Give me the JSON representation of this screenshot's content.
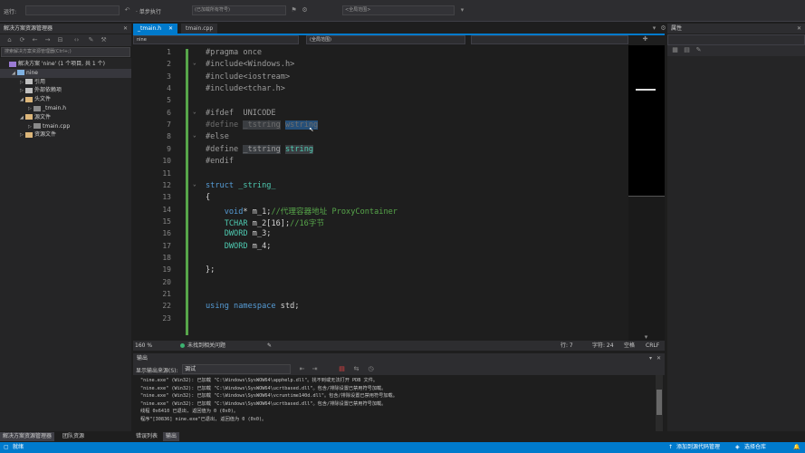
{
  "toolbar": {
    "find_label": "运行:",
    "find_value": "",
    "symbol_combo": "<全局范围>",
    "line_combo": "(已加载所有符号)",
    "nav_label": "· 单步执行",
    "nav_combo": ""
  },
  "solution_explorer": {
    "title": "解决方案资源管理器",
    "search_placeholder": "搜索解决方案资源管理器(Ctrl+;)",
    "items": [
      {
        "label": "解决方案 'nine' (1 个项目, 共 1 个)",
        "indent": 0,
        "expanded": false,
        "icon": "solution-icon"
      },
      {
        "label": "nine",
        "indent": 1,
        "expanded": true,
        "icon": "project-icon",
        "selected": true
      },
      {
        "label": "引用",
        "indent": 2,
        "expanded": false,
        "icon": "reference-icon"
      },
      {
        "label": "外部依赖项",
        "indent": 2,
        "expanded": false,
        "icon": "dependency-icon"
      },
      {
        "label": "头文件",
        "indent": 2,
        "expanded": true,
        "icon": "folder-icon"
      },
      {
        "label": "_tmain.h",
        "indent": 3,
        "expanded": false,
        "icon": "header-file-icon"
      },
      {
        "label": "源文件",
        "indent": 2,
        "expanded": true,
        "icon": "folder-icon"
      },
      {
        "label": "tmain.cpp",
        "indent": 3,
        "expanded": false,
        "icon": "cpp-file-icon"
      },
      {
        "label": "资源文件",
        "indent": 2,
        "expanded": false,
        "icon": "folder-icon"
      }
    ],
    "bottom_tabs": [
      "解决方案资源管理器",
      "团队资源"
    ]
  },
  "editor": {
    "tabs": [
      {
        "label": "_tmain.h",
        "active": true
      },
      {
        "label": "tmain.cpp",
        "active": false
      }
    ],
    "nav_project": "nine",
    "nav_scope": "(全局范围)",
    "nav_member": "",
    "lines": [
      {
        "n": "1",
        "parts": [
          {
            "t": "#pragma once",
            "c": "pp"
          }
        ]
      },
      {
        "n": "2",
        "parts": [
          {
            "t": "#include",
            "c": "pp"
          },
          {
            "t": "<Windows.h>",
            "c": "pp"
          }
        ]
      },
      {
        "n": "3",
        "parts": [
          {
            "t": "#include",
            "c": "pp"
          },
          {
            "t": "<iostream>",
            "c": "pp"
          }
        ]
      },
      {
        "n": "4",
        "parts": [
          {
            "t": "#include",
            "c": "pp"
          },
          {
            "t": "<tchar.h>",
            "c": "pp"
          }
        ]
      },
      {
        "n": "5",
        "parts": []
      },
      {
        "n": "6",
        "parts": [
          {
            "t": "#ifdef  UNICODE",
            "c": "pp"
          }
        ]
      },
      {
        "n": "7",
        "parts": [
          {
            "t": "#define ",
            "c": "dim"
          },
          {
            "t": "_tstring",
            "c": "dim ref"
          },
          {
            "t": " ",
            "c": ""
          },
          {
            "t": "wstring",
            "c": "dim hl"
          }
        ]
      },
      {
        "n": "8",
        "parts": [
          {
            "t": "#else",
            "c": "pp"
          }
        ]
      },
      {
        "n": "9",
        "parts": [
          {
            "t": "#define ",
            "c": "pp"
          },
          {
            "t": "_tstring",
            "c": "pp ref"
          },
          {
            "t": " ",
            "c": ""
          },
          {
            "t": "string",
            "c": "typ ref"
          }
        ]
      },
      {
        "n": "10",
        "parts": [
          {
            "t": "#endif",
            "c": "pp"
          }
        ]
      },
      {
        "n": "11",
        "parts": []
      },
      {
        "n": "12",
        "parts": [
          {
            "t": "struct ",
            "c": "kw"
          },
          {
            "t": "_string_",
            "c": "typ"
          }
        ]
      },
      {
        "n": "13",
        "parts": [
          {
            "t": "{",
            "c": ""
          }
        ]
      },
      {
        "n": "14",
        "parts": [
          {
            "t": "    ",
            "c": ""
          },
          {
            "t": "void",
            "c": "kw"
          },
          {
            "t": "* m_1;",
            "c": ""
          },
          {
            "t": "//代理容器地址 ProxyContainer",
            "c": "cm"
          }
        ]
      },
      {
        "n": "15",
        "parts": [
          {
            "t": "    ",
            "c": ""
          },
          {
            "t": "TCHAR",
            "c": "typ"
          },
          {
            "t": " m_2[16];",
            "c": ""
          },
          {
            "t": "//16字节",
            "c": "cm"
          }
        ]
      },
      {
        "n": "16",
        "parts": [
          {
            "t": "    ",
            "c": ""
          },
          {
            "t": "DWORD",
            "c": "typ"
          },
          {
            "t": " m_3;",
            "c": ""
          }
        ]
      },
      {
        "n": "17",
        "parts": [
          {
            "t": "    ",
            "c": ""
          },
          {
            "t": "DWORD",
            "c": "typ"
          },
          {
            "t": " m_4;",
            "c": ""
          }
        ]
      },
      {
        "n": "18",
        "parts": []
      },
      {
        "n": "19",
        "parts": [
          {
            "t": "};",
            "c": ""
          }
        ]
      },
      {
        "n": "20",
        "parts": []
      },
      {
        "n": "21",
        "parts": []
      },
      {
        "n": "22",
        "parts": [
          {
            "t": "using namespace ",
            "c": "kw"
          },
          {
            "t": "std;",
            "c": ""
          }
        ]
      },
      {
        "n": "23",
        "parts": []
      }
    ],
    "status": {
      "zoom": "160 %",
      "issues": "未找到相关问题",
      "line": "行: 7",
      "char": "字符: 24",
      "mode": "空格",
      "eol": "CRLF"
    }
  },
  "properties": {
    "title": "属性"
  },
  "output": {
    "title": "输出",
    "show_label": "显示输出来源(S):",
    "source": "调试",
    "lines": [
      "\"nine.exe\" (Win32): 已加载 \"C:\\Windows\\SysWOW64\\apphelp.dll\"。找不到或无法打开 PDB 文件。",
      "\"nine.exe\" (Win32): 已加载 \"C:\\Windows\\SysWOW64\\ucrtbased.dll\"。包含/排除设置已禁用符号加载。",
      "\"nine.exe\" (Win32): 已加载 \"C:\\Windows\\SysWOW64\\vcruntime140d.dll\"。包含/排除设置已禁用符号加载。",
      "\"nine.exe\" (Win32): 已加载 \"C:\\Windows\\SysWOW64\\ucrtbased.dll\"。包含/排除设置已禁用符号加载。",
      "线程 0x6410 已退出, 返回值为 0 (0x0)。",
      "程序\"[30836] nine.exe\"已退出, 返回值为 0 (0x0)。"
    ],
    "bottom_tabs": [
      "错误列表",
      "输出"
    ]
  },
  "statusbar": {
    "left": "就绪",
    "right1": "添加到源代码管理",
    "right2": "选择仓库"
  }
}
